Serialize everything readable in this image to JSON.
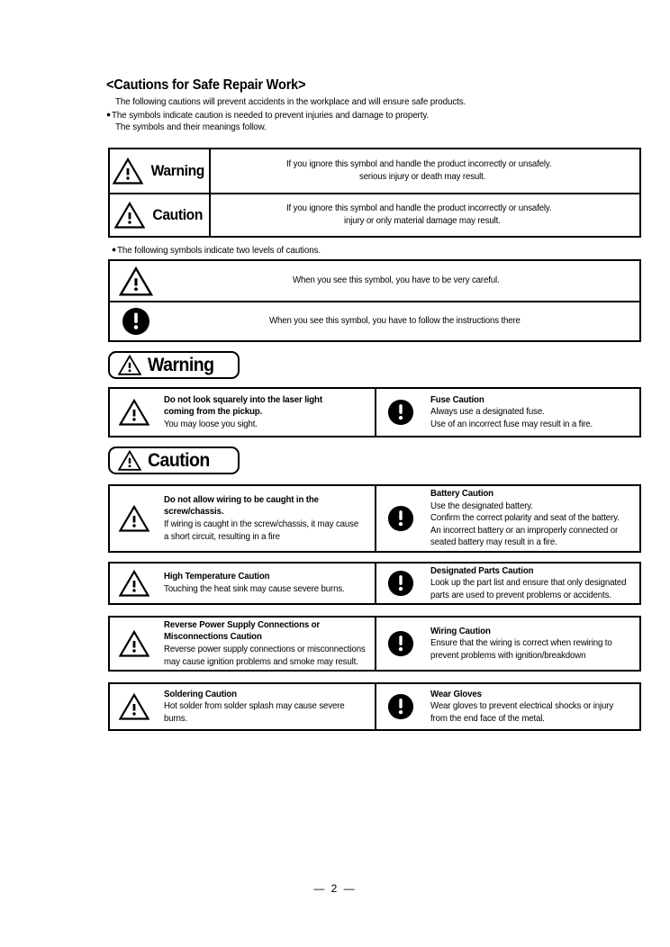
{
  "document": {
    "title": "<Cautions for Safe Repair Work>",
    "intro_lines": [
      "The following cautions will prevent accidents in the workplace and will ensure safe products.",
      "The symbols indicate caution is needed to prevent injuries and damage to property.",
      "The symbols and their meanings follow."
    ],
    "bullet_glyph": "●",
    "page_number": "— 2 —"
  },
  "levels_table": {
    "rows": [
      {
        "icon": "warning-triangle-icon",
        "label": "Warning",
        "lines": [
          "If you ignore this symbol and handle the product incorrectly or unsafely.",
          "serious injury or death may result."
        ]
      },
      {
        "icon": "warning-triangle-icon",
        "label": "Caution",
        "lines": [
          "If you ignore this symbol and handle the product incorrectly or unsafely.",
          "injury or only material damage may result."
        ]
      }
    ]
  },
  "symbols_note": "The following symbols indicate two levels of cautions.",
  "symbols_table": {
    "rows": [
      {
        "icon": "warning-triangle-icon",
        "lines": [
          "When you see this symbol, you have to be very careful."
        ]
      },
      {
        "icon": "exclamation-circle-icon",
        "lines": [
          "When you see this symbol, you have to follow the instructions there"
        ]
      }
    ]
  },
  "warning_section": {
    "header_label": "Warning",
    "header_icon": "warning-triangle-icon",
    "rows": [
      {
        "left": {
          "icon": "warning-triangle-icon",
          "lines": [
            "Do not look squarely into the laser light",
            "coming from the pickup.",
            "You may loose you sight."
          ],
          "bold_count": 2
        },
        "right": {
          "icon": "exclamation-circle-icon",
          "lines": [
            "Fuse Caution",
            "Always use a designated fuse.",
            "Use of an incorrect fuse may result in a fire."
          ],
          "bold_count": 1
        }
      }
    ]
  },
  "caution_section": {
    "header_label": "Caution",
    "header_icon": "warning-triangle-icon",
    "rows": [
      {
        "left": {
          "icon": "warning-triangle-icon",
          "lines": [
            "Do not allow wiring to be caught in the",
            "screw/chassis.",
            "If wiring is caught in the screw/chassis, it may cause",
            "a short circuit, resulting in a fire"
          ],
          "bold_count": 2
        },
        "right": {
          "icon": "exclamation-circle-icon",
          "lines": [
            "Battery Caution",
            "Use the designated battery.",
            "Confirm the correct polarity and seat of the battery.",
            "An incorrect battery or an improperly connected or",
            "seated battery may result in a fire."
          ],
          "bold_count": 1
        }
      },
      {
        "left": {
          "icon": "warning-triangle-icon",
          "lines": [
            "High Temperature Caution",
            "Touching the heat sink may cause severe burns."
          ],
          "bold_count": 1
        },
        "right": {
          "icon": "exclamation-circle-icon",
          "lines": [
            "Designated Parts Caution",
            "Look up the part list and ensure that only designated",
            "parts are used to prevent problems or accidents."
          ],
          "bold_count": 1
        }
      },
      {
        "left": {
          "icon": "warning-triangle-icon",
          "lines": [
            "Reverse Power Supply Connections or",
            "Misconnections Caution",
            "Reverse power supply connections or misconnections",
            "may cause ignition problems and smoke may result."
          ],
          "bold_count": 2
        },
        "right": {
          "icon": "exclamation-circle-icon",
          "lines": [
            "Wiring Caution",
            "Ensure that the wiring is correct when rewiring to",
            "prevent problems with ignition/breakdown"
          ],
          "bold_count": 1
        }
      },
      {
        "left": {
          "icon": "warning-triangle-icon",
          "lines": [
            "Soldering Caution",
            "Hot solder from solder splash may cause severe",
            "burns."
          ],
          "bold_count": 1
        },
        "right": {
          "icon": "exclamation-circle-icon",
          "lines": [
            "Wear Gloves",
            "Wear gloves to prevent electrical shocks or injury",
            "from the end face of the metal."
          ],
          "bold_count": 1
        }
      }
    ]
  },
  "colors": {
    "ink": "#000000",
    "paper": "#ffffff"
  }
}
